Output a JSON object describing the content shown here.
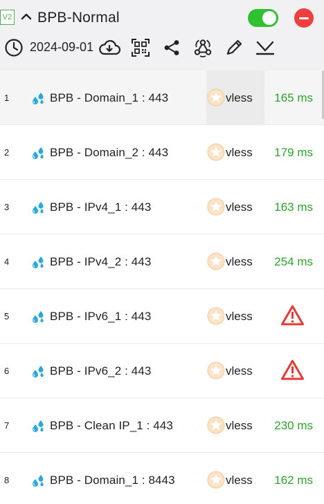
{
  "header": {
    "badge": "V2",
    "profile_name": "BPB-Normal",
    "enabled": true,
    "update_date": "2024-09-01",
    "colors": {
      "toggle_on": "#2fc12f",
      "remove": "#ee3e3e",
      "badge": "#4caf50"
    },
    "toolbar_icons": [
      "cloud-download-icon",
      "qr-code-icon",
      "share-icon",
      "webhook-icon",
      "edit-icon",
      "sort-icon"
    ]
  },
  "servers": [
    {
      "index": "1",
      "name": "BPB - Domain_1 : 443",
      "protocol": "vless",
      "delay": "165 ms",
      "status": "ok",
      "selected": true
    },
    {
      "index": "2",
      "name": "BPB - Domain_2 : 443",
      "protocol": "vless",
      "delay": "179 ms",
      "status": "ok"
    },
    {
      "index": "3",
      "name": "BPB - IPv4_1 : 443",
      "protocol": "vless",
      "delay": "163 ms",
      "status": "ok"
    },
    {
      "index": "4",
      "name": "BPB - IPv4_2 : 443",
      "protocol": "vless",
      "delay": "254 ms",
      "status": "ok"
    },
    {
      "index": "5",
      "name": "BPB - IPv6_1 : 443",
      "protocol": "vless",
      "delay": "",
      "status": "error"
    },
    {
      "index": "6",
      "name": "BPB - IPv6_2 : 443",
      "protocol": "vless",
      "delay": "",
      "status": "error"
    },
    {
      "index": "7",
      "name": "BPB - Clean IP_1 : 443",
      "protocol": "vless",
      "delay": "230 ms",
      "status": "ok"
    },
    {
      "index": "8",
      "name": "BPB - Domain_1 : 8443",
      "protocol": "vless",
      "delay": "162 ms",
      "status": "ok"
    }
  ],
  "colors": {
    "delay_ok": "#2ca42c",
    "warning": "#e53935",
    "drop": "#29a8e0",
    "star": "#f3c89a"
  }
}
